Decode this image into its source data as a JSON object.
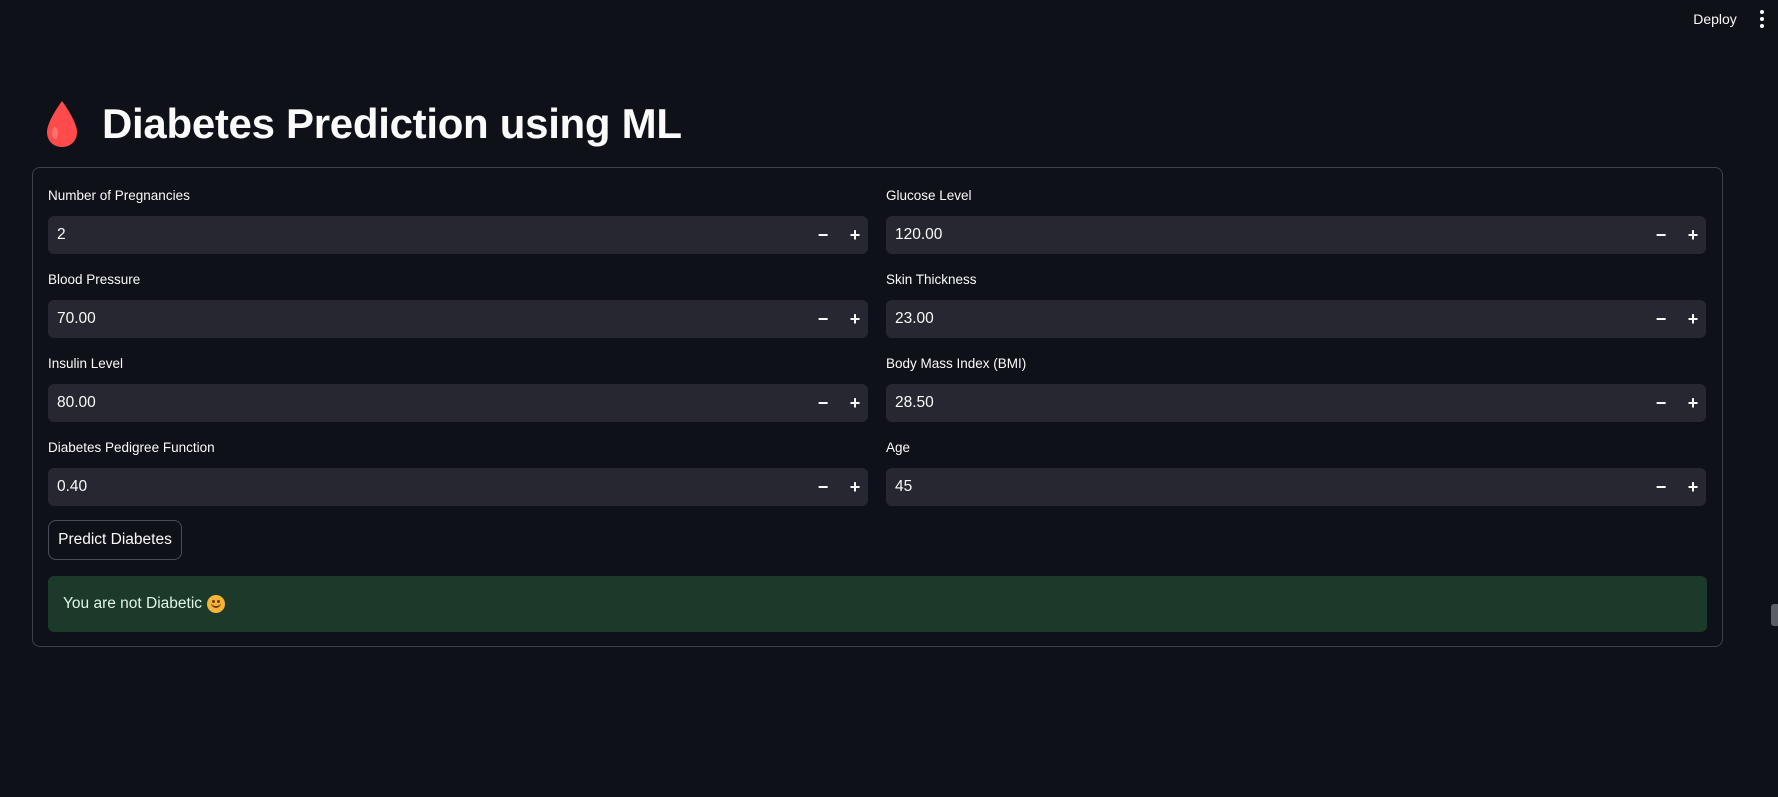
{
  "header": {
    "deploy_label": "Deploy",
    "menu_icon": "vertical-ellipsis-icon"
  },
  "page": {
    "title": "Diabetes Prediction using ML",
    "title_icon": "blood-drop-icon"
  },
  "form": {
    "fields": [
      {
        "label": "Number of Pregnancies",
        "value": "2"
      },
      {
        "label": "Glucose Level",
        "value": "120.00"
      },
      {
        "label": "Blood Pressure",
        "value": "70.00"
      },
      {
        "label": "Skin Thickness",
        "value": "23.00"
      },
      {
        "label": "Insulin Level",
        "value": "80.00"
      },
      {
        "label": "Body Mass Index (BMI)",
        "value": "28.50"
      },
      {
        "label": "Diabetes Pedigree Function",
        "value": "0.40"
      },
      {
        "label": "Age",
        "value": "45"
      }
    ],
    "stepper": {
      "minus": "−",
      "plus": "+"
    },
    "predict_label": "Predict Diabetes"
  },
  "result": {
    "message": "You are not Diabetic",
    "emoji_icon": "smiling-face-icon"
  },
  "colors": {
    "background": "#0e1117",
    "input_bg": "#262730",
    "success_bg": "#1b3a2a",
    "drop_red": "#ff4b4b"
  }
}
